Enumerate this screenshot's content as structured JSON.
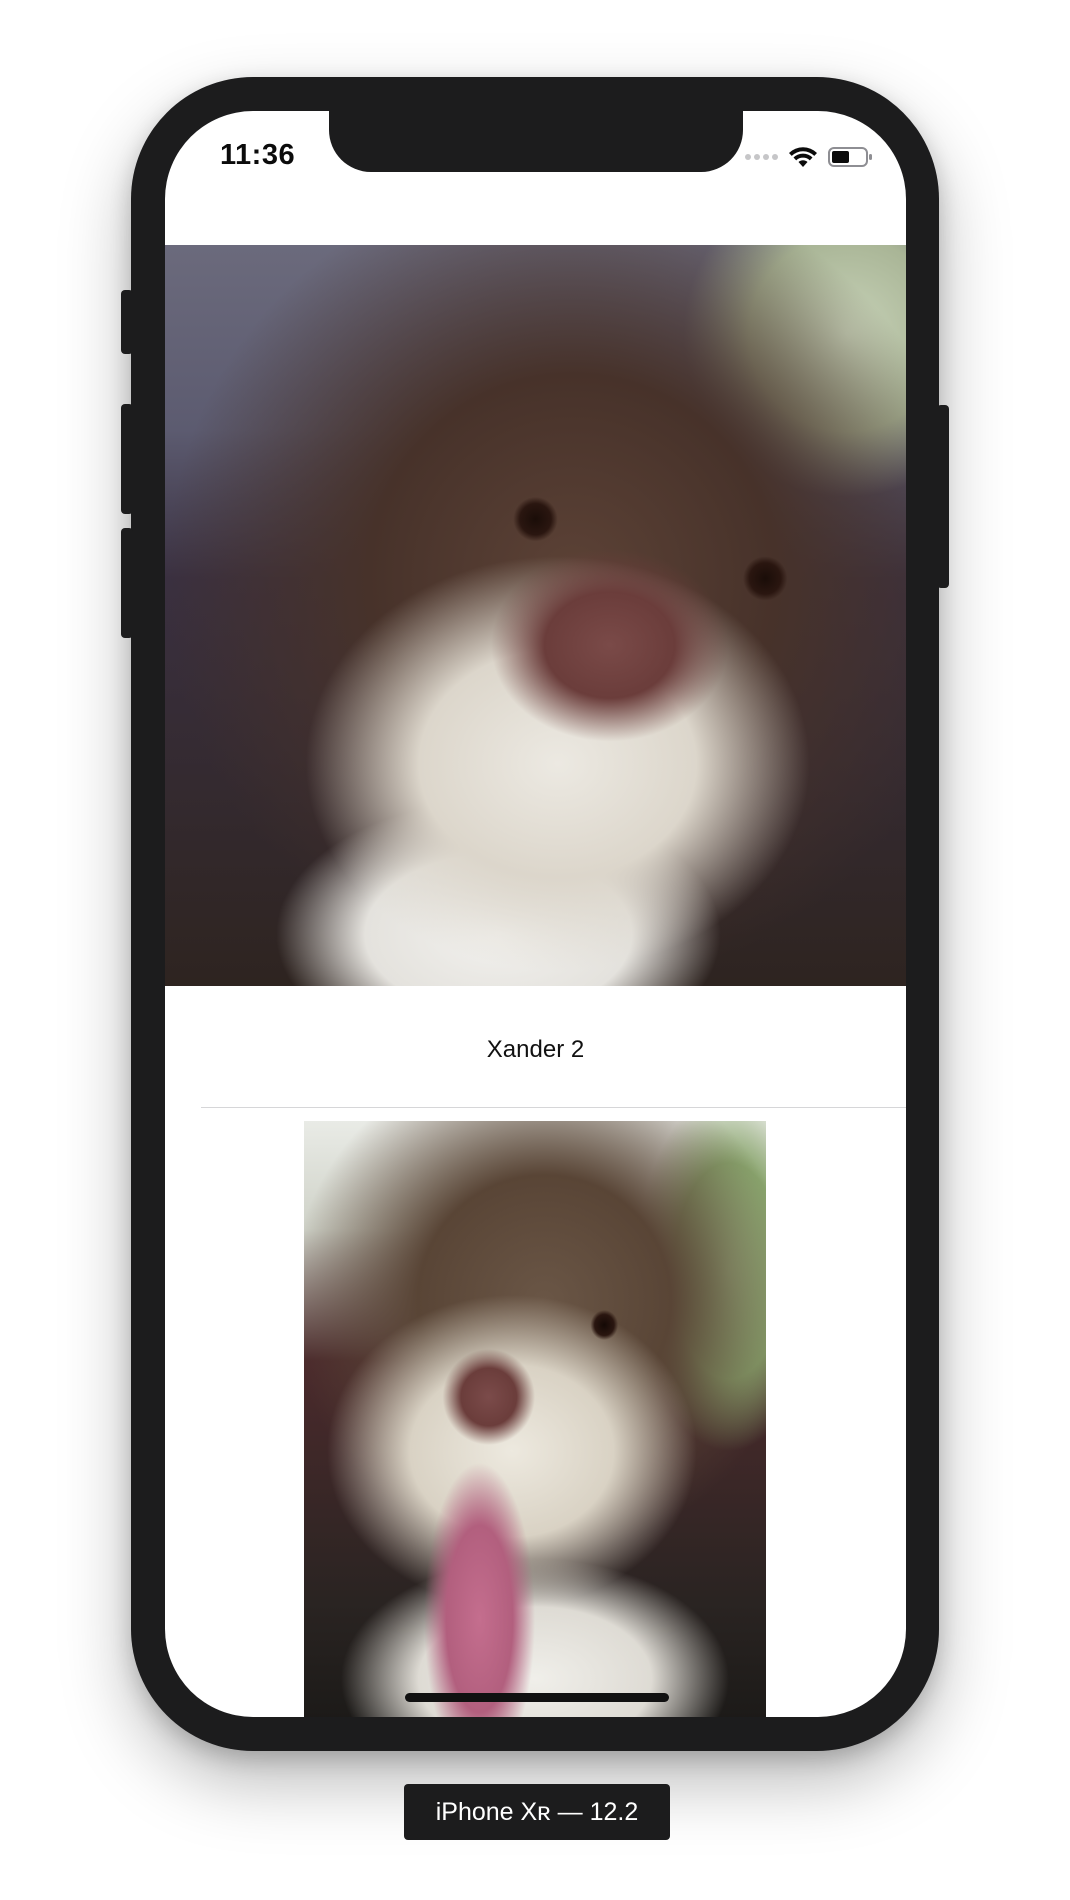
{
  "status_bar": {
    "time": "11:36",
    "icons": [
      "signal-dots-icon",
      "wifi-icon",
      "battery-icon"
    ]
  },
  "list": {
    "items": [
      {
        "caption": "",
        "image": "dog-photo-1"
      },
      {
        "caption": "Xander 2",
        "image": "dog-photo-2"
      }
    ]
  },
  "simulator": {
    "device_label": "iPhone Xʀ — 12.2"
  },
  "colors": {
    "frame": "#1c1c1d",
    "screen_background": "#ffffff",
    "separator": "#d6d6d8",
    "text": "#111111"
  }
}
